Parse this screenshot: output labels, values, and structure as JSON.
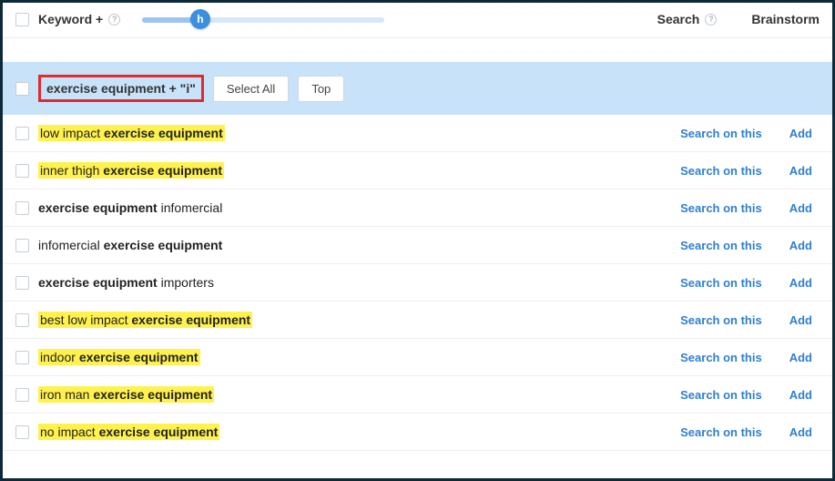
{
  "header": {
    "keyword_col": "Keyword +",
    "slider_letter": "h",
    "search_col": "Search",
    "brainstorm_col": "Brainstorm"
  },
  "group": {
    "title": "exercise equipment + \"i\"",
    "select_all": "Select All",
    "top": "Top"
  },
  "actions": {
    "search_on_this": "Search on this",
    "add": "Add"
  },
  "rows": [
    {
      "highlighted": true,
      "pre": "low impact ",
      "bold": "exercise equipment",
      "post": ""
    },
    {
      "highlighted": true,
      "pre": "inner thigh ",
      "bold": "exercise equipment",
      "post": ""
    },
    {
      "highlighted": false,
      "pre": "",
      "bold": "exercise equipment",
      "post": " infomercial"
    },
    {
      "highlighted": false,
      "pre": "infomercial ",
      "bold": "exercise equipment",
      "post": ""
    },
    {
      "highlighted": false,
      "pre": "",
      "bold": "exercise equipment",
      "post": " importers"
    },
    {
      "highlighted": true,
      "pre": "best low impact ",
      "bold": "exercise equipment",
      "post": ""
    },
    {
      "highlighted": true,
      "pre": "indoor ",
      "bold": "exercise equipment",
      "post": ""
    },
    {
      "highlighted": true,
      "pre": "iron man ",
      "bold": "exercise equipment",
      "post": ""
    },
    {
      "highlighted": true,
      "pre": "no impact ",
      "bold": "exercise equipment",
      "post": ""
    }
  ]
}
